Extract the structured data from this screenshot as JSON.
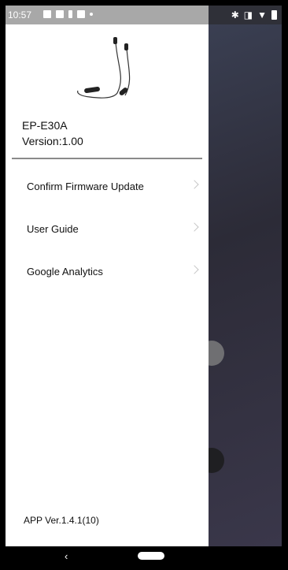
{
  "status_bar": {
    "time": "10:57"
  },
  "drawer": {
    "device_name": "EP-E30A",
    "device_version": "Version:1.00",
    "menu_items": [
      {
        "label": "Confirm Firmware Update"
      },
      {
        "label": "User Guide"
      },
      {
        "label": "Google Analytics"
      }
    ],
    "app_version": "APP Ver.1.4.1(10)"
  },
  "colors": {
    "drawer_bg": "#ffffff",
    "status_bar_drawer": "#a8a8a8",
    "background_dim": "#2e2d38"
  }
}
